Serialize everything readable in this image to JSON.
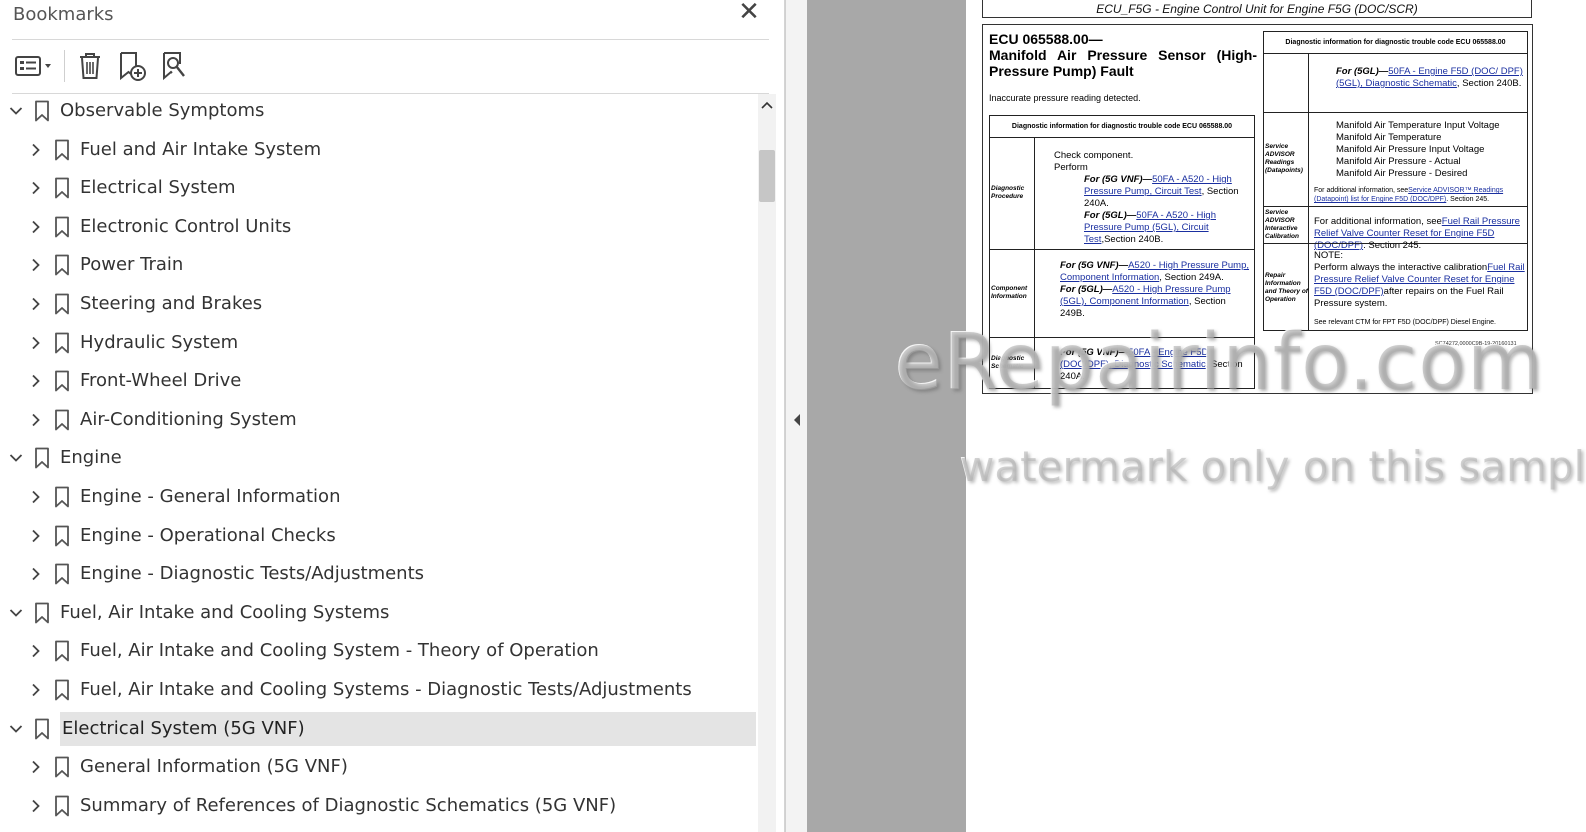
{
  "bookmarks_panel": {
    "title": "Bookmarks",
    "close_glyph": "✕",
    "toolbar": {
      "options_icon": "list-options-icon",
      "delete_icon": "trash-icon",
      "add_icon": "add-bookmark-icon",
      "find_icon": "find-bookmark-icon"
    },
    "items": [
      {
        "label": "Observable Symptoms",
        "level": 0,
        "expanded": true,
        "selected": false
      },
      {
        "label": "Fuel and Air Intake System",
        "level": 1,
        "expanded": false,
        "selected": false
      },
      {
        "label": "Electrical System",
        "level": 1,
        "expanded": false,
        "selected": false
      },
      {
        "label": "Electronic Control Units",
        "level": 1,
        "expanded": false,
        "selected": false
      },
      {
        "label": "Power Train",
        "level": 1,
        "expanded": false,
        "selected": false
      },
      {
        "label": "Steering and Brakes",
        "level": 1,
        "expanded": false,
        "selected": false
      },
      {
        "label": "Hydraulic System",
        "level": 1,
        "expanded": false,
        "selected": false
      },
      {
        "label": "Front-Wheel Drive",
        "level": 1,
        "expanded": false,
        "selected": false
      },
      {
        "label": "Air-Conditioning System",
        "level": 1,
        "expanded": false,
        "selected": false
      },
      {
        "label": "Engine",
        "level": 0,
        "expanded": true,
        "selected": false
      },
      {
        "label": "Engine - General Information",
        "level": 1,
        "expanded": false,
        "selected": false
      },
      {
        "label": "Engine - Operational Checks",
        "level": 1,
        "expanded": false,
        "selected": false
      },
      {
        "label": "Engine - Diagnostic Tests/Adjustments",
        "level": 1,
        "expanded": false,
        "selected": false
      },
      {
        "label": "Fuel, Air Intake and Cooling Systems",
        "level": 0,
        "expanded": true,
        "selected": false
      },
      {
        "label": "Fuel, Air Intake and Cooling System - Theory of Operation",
        "level": 1,
        "expanded": false,
        "selected": false
      },
      {
        "label": "Fuel, Air Intake and Cooling Systems - Diagnostic Tests/Adjustments",
        "level": 1,
        "expanded": false,
        "selected": false
      },
      {
        "label": "Electrical System (5G VNF)",
        "level": 0,
        "expanded": true,
        "selected": true
      },
      {
        "label": "General Information (5G VNF)",
        "level": 1,
        "expanded": false,
        "selected": false
      },
      {
        "label": "Summary of References of Diagnostic Schematics (5G VNF)",
        "level": 1,
        "expanded": false,
        "selected": false
      }
    ]
  },
  "document": {
    "header": "ECU_F5G - Engine Control Unit for Engine F5G (DOC/SCR)",
    "title_code": "ECU 065588.00—",
    "title_text": "Manifold Air Pressure Sensor (High-Pressure Pump) Fault",
    "subtitle": "Inaccurate pressure reading detected.",
    "left_table": {
      "header": "Diagnostic information for diagnostic trouble code ECU 065588.00",
      "rows": {
        "procedure_label": "Diagnostic Procedure",
        "procedure_l1": "Check component.",
        "procedure_l2": "Perform",
        "procedure_a_prefix": "For (5G VNF)—",
        "procedure_a_link": "50FA - A520 - High Pressure Pump, Circuit Test",
        "procedure_a_suffix": ", Section 240A.",
        "procedure_b_prefix": "For (5GL)—",
        "procedure_b_link": "50FA - A520 - High Pressure Pump (5GL), Circuit Test",
        "procedure_b_suffix": ",Section 240B.",
        "component_label": "Component Information",
        "component_a_prefix": "For (5G VNF)—",
        "component_a_link": "A520 - High Pressure Pump, Component Information",
        "component_a_suffix": ", Section 249A.",
        "component_b_prefix": "For (5GL)—",
        "component_b_link": "A520 - High Pressure Pump (5GL), Component Information",
        "component_b_suffix": ", Section 249B.",
        "schematic_label": "Diagnostic Schematic",
        "schematic_a_prefix": "For (5G VNF)—",
        "schematic_a_link": "50FA - Engine F5D (DOC/DPF), Diagnostic Schematic",
        "schematic_a_suffix": ", Section 240A."
      }
    },
    "right_table": {
      "header": "Diagnostic information for diagnostic trouble code ECU 065588.00",
      "schematic_b_prefix": "For (5GL)—",
      "schematic_b_link": "50FA - Engine F5D (DOC/ DPF) (5GL), Diagnostic Schematic",
      "schematic_b_suffix": ", Section 240B.",
      "readings_label": "Service ADVISOR Readings (Datapoints)",
      "readings": [
        "Manifold Air Temperature Input Voltage",
        "Manifold Air Temperature",
        "Manifold Air Pressure Input Voltage",
        "Manifold Air Pressure - Actual",
        "Manifold Air Pressure - Desired"
      ],
      "readings_note_prefix": "For additional information, see",
      "readings_note_link": "Service ADVISOR™ Readings (Datapoint) list for Engine F5D (DOC/DPF)",
      "readings_note_suffix": ". Section 245.",
      "calibration_label": "Service ADVISOR Interactive Calibration",
      "calibration_note_prefix": "For additional information, see",
      "calibration_note_link": "Fuel Rail Pressure Relief Valve Counter Reset for Engine F5D (DOC/DPF)",
      "calibration_note_suffix": ". Section 245.",
      "repair_label": "Repair Information and Theory of Operation",
      "repair_note": "NOTE:",
      "repair_text_prefix": "Perform always the interactive calibration",
      "repair_text_link": "Fuel Rail Pressure Relief Valve Counter Reset for Engine F5D (DOC/DPF)",
      "repair_text_suffix": "after repairs on the Fuel Rail Pressure system.",
      "repair_ctm": "See relevant CTM for FPT F5D (DOC/DPF) Diesel Engine.",
      "ref_code": "SC74272,0000C9B-19-20160131"
    }
  },
  "watermark": {
    "line1": "eRepairinfo.com",
    "line2": "watermark only on this sample"
  }
}
